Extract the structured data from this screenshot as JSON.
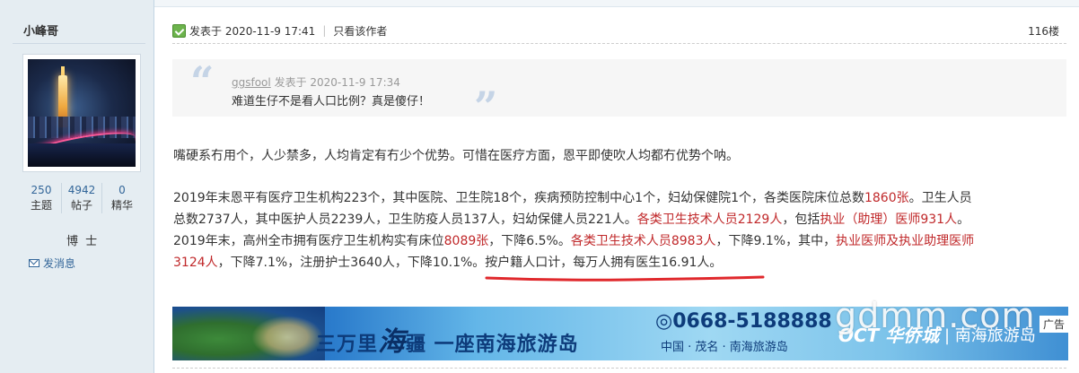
{
  "author": {
    "name": "小峰哥",
    "stats": [
      {
        "value": "250",
        "label": "主题"
      },
      {
        "value": "4942",
        "label": "帖子"
      },
      {
        "value": "0",
        "label": "精华"
      }
    ],
    "rank": "博 士",
    "send_message": "发消息"
  },
  "post": {
    "posted_at": "发表于 2020-11-9 17:41",
    "only_author": "只看该作者",
    "floor": "116楼",
    "quote": {
      "user": "ggsfool",
      "meta_suffix": "发表于 2020-11-9 17:34",
      "text": "难道生仔不是看人口比例？真是傻仔！"
    },
    "paragraph1": "嘴硬系冇用个，人少禁多，人均肯定有冇少个优势。可惜在医疗方面，恩平即使吹人均都冇优势个呐。",
    "line1a": "2019年末恩平有医疗卫生机构223个，其中医院、卫生院18个，疾病预防控制中心1个，妇幼保健院1个，各类医院床位总数",
    "line1b": "1860张",
    "line1c": "。卫生人员",
    "line2a": "总数2737人，其中医护人员2239人，卫生防疫人员137人，妇幼保健人员221人。",
    "line2b": "各类卫生技术人员2129人",
    "line2c": "，包括",
    "line2d": "执业（助理）医师931人",
    "line2e": "。",
    "line3a": "2019年末，高州全市拥有医疗卫生机构实有床位",
    "line3b": "8089张",
    "line3c": "，下降6.5%。",
    "line3d": "各类卫生技术人员8983人",
    "line3e": "，下降9.1%，其中，",
    "line3f": "执业医师及执业助理医师",
    "line4a": "3124人",
    "line4b": "，下降7.1%，注册护士3640人，下降10.1%。按户籍人口计，每万人拥有医生16.91人。"
  },
  "banner": {
    "slogan_a": "三万里",
    "slogan_hai": "海",
    "slogan_b": "疆  一座南海旅游岛",
    "phone": "◎0668-5188888",
    "sub": "中国 · 茂名 · 南海旅游岛",
    "brand": "OCT 华侨城",
    "brand2": "| 南海旅游岛",
    "ad_tag": "广告"
  },
  "watermark": "gdmm.com",
  "colors": {
    "link": "#336699",
    "highlight_red": "#c0282a",
    "sidebar_bg": "#e5edf2",
    "underline_red": "#e0282c"
  }
}
